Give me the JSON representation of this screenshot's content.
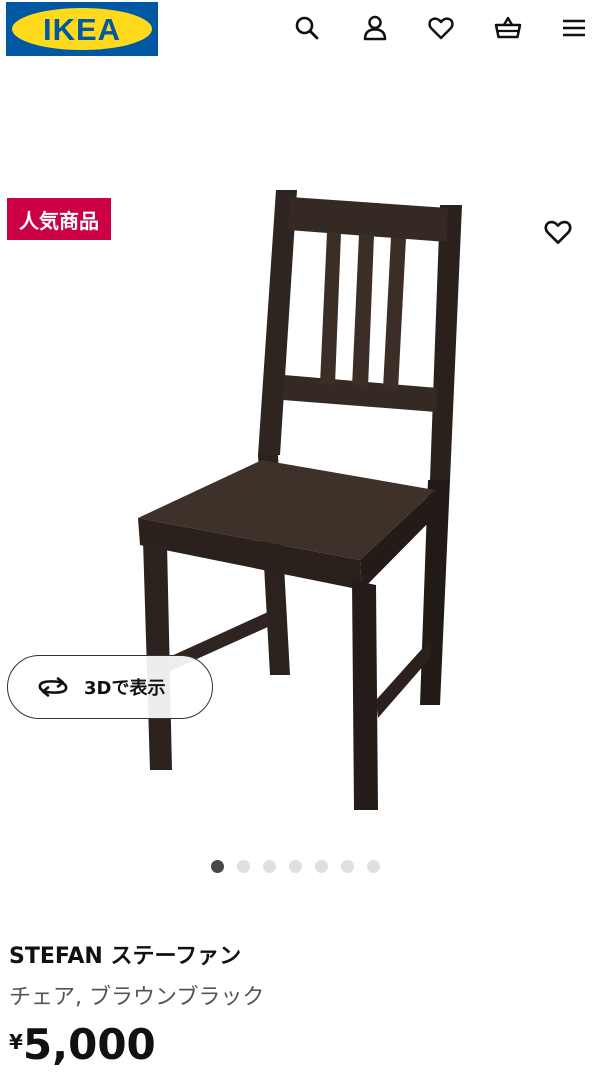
{
  "header": {
    "logo_text": "IKEA",
    "icons": [
      "search-icon",
      "user-icon",
      "heart-icon",
      "basket-icon",
      "menu-icon"
    ]
  },
  "gallery": {
    "badge": "人気商品",
    "view3d_label": "3Dで表示",
    "dots_total": 7,
    "dots_active_index": 0
  },
  "product": {
    "name": "STEFAN ステーファン",
    "description": "チェア, ブラウンブラック",
    "currency": "¥",
    "price": "5,000"
  },
  "colors": {
    "brand_blue": "#0058a3",
    "brand_yellow": "#ffda1a",
    "badge_red": "#cc0044",
    "chair_brown": "#2f2520"
  }
}
